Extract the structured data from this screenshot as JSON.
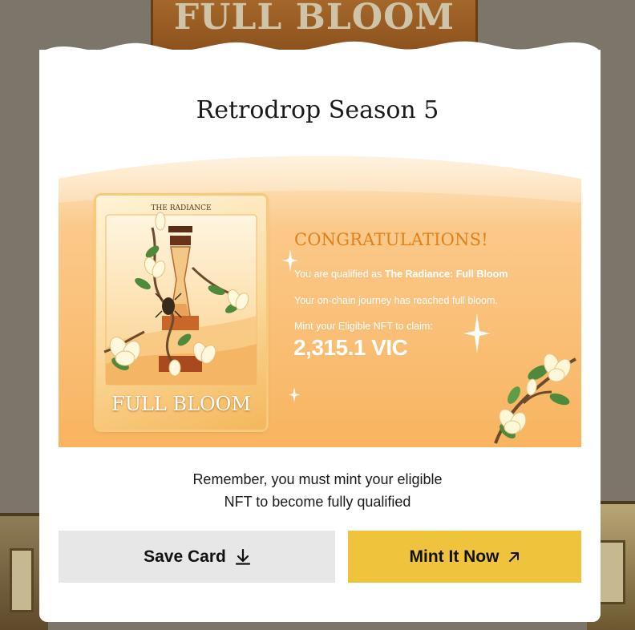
{
  "background": {
    "sign_text": "FULL BLOOM"
  },
  "modal": {
    "title": "Retrodrop Season 5"
  },
  "card": {
    "top_label": "THE RADIANCE",
    "bottom_label": "FULL BLOOM"
  },
  "banner": {
    "congrats": "CONGRATULATIONS!",
    "qualified_prefix": "You are qualified as ",
    "qualified_tier": "The Radiance: Full Bloom",
    "journey_text": "Your on-chain journey has reached full bloom.",
    "mint_prompt": "Mint your Eligible NFT to claim:",
    "amount": "2,315.1 VIC"
  },
  "reminder": {
    "line1": "Remember, you must mint your eligible",
    "line2": "NFT to become fully qualified"
  },
  "buttons": {
    "save_label": "Save Card",
    "save_icon": "download-icon",
    "mint_label": "Mint It Now",
    "mint_icon": "arrow-up-right-icon"
  },
  "colors": {
    "accent_orange": "#e2811a",
    "mint_button": "#efc43c",
    "save_button": "#e7e7e7"
  }
}
